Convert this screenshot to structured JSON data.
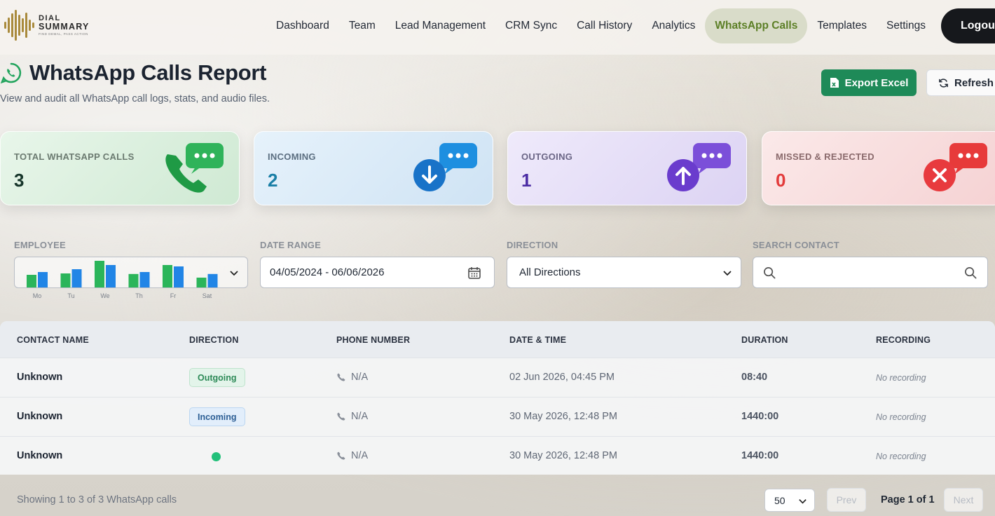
{
  "brand": {
    "line1": "DIAL",
    "line2": "SUMMARY",
    "tagline": "FIND DEMAL, PASS ACTION"
  },
  "nav": {
    "items": [
      "Dashboard",
      "Team",
      "Lead Management",
      "CRM Sync",
      "Call History",
      "Analytics",
      "WhatsApp Calls",
      "Templates",
      "Settings"
    ],
    "active": "WhatsApp Calls",
    "logout": "Logout"
  },
  "header": {
    "title": "WhatsApp Calls Report",
    "subtitle": "View and audit all WhatsApp call logs, stats, and audio files.",
    "export_label": "Export Excel",
    "refresh_label": "Refresh"
  },
  "stats": [
    {
      "label": "TOTAL WHATSAPP CALLS",
      "value": "3"
    },
    {
      "label": "INCOMING",
      "value": "2"
    },
    {
      "label": "OUTGOING",
      "value": "1"
    },
    {
      "label": "MISSED & REJECTED",
      "value": "0"
    }
  ],
  "filters": {
    "employee_label": "EMPLOYEE",
    "date_label": "DATE RANGE",
    "date_value": "04/05/2024 - 06/06/2026",
    "direction_label": "DIRECTION",
    "direction_value": "All Directions",
    "search_label": "SEARCH CONTACT",
    "search_placeholder": ""
  },
  "employee_chart": {
    "days": [
      "Mo",
      "Tu",
      "We",
      "Th",
      "Fr",
      "Sat"
    ],
    "green": [
      0.45,
      0.5,
      0.95,
      0.48,
      0.8,
      0.35
    ],
    "blue": [
      0.55,
      0.65,
      0.8,
      0.55,
      0.75,
      0.48
    ]
  },
  "table": {
    "columns": [
      "CONTACT NAME",
      "DIRECTION",
      "PHONE NUMBER",
      "DATE & TIME",
      "DURATION",
      "RECORDING"
    ],
    "rows": [
      {
        "name": "Unknown",
        "direction": "Outgoing",
        "phone": "N/A",
        "datetime": "02 Jun 2026, 04:45 PM",
        "duration": "08:40",
        "recording": "No recording"
      },
      {
        "name": "Unknown",
        "direction": "Incoming",
        "phone": "N/A",
        "datetime": "30 May 2026, 12:48 PM",
        "duration": "1440:00",
        "recording": "No recording"
      },
      {
        "name": "Unknown",
        "direction": "",
        "phone": "N/A",
        "datetime": "30 May 2026, 12:48 PM",
        "duration": "1440:00",
        "recording": "No recording"
      }
    ]
  },
  "footer": {
    "showing": "Showing 1 to 3 of 3 WhatsApp calls",
    "per_page": "50",
    "prev": "Prev",
    "page_info": "Page 1 of 1",
    "next": "Next"
  },
  "colors": {
    "accent_green": "#1e8a58",
    "active_nav": "#5c7f26",
    "missed_red": "#e33b3b"
  }
}
